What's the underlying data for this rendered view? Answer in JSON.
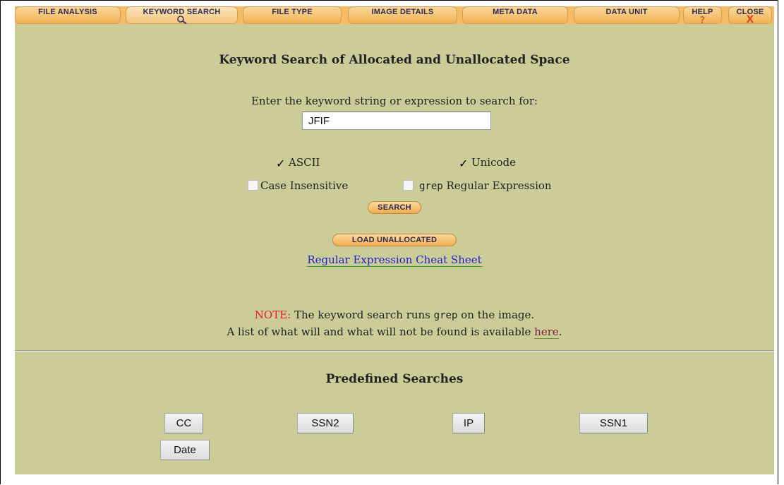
{
  "tabs": [
    {
      "label": "File Analysis"
    },
    {
      "label": "Keyword Search",
      "icon": "magnifier-icon"
    },
    {
      "label": "File Type"
    },
    {
      "label": "Image Details"
    },
    {
      "label": "Meta Data"
    },
    {
      "label": "Data Unit"
    },
    {
      "label": "Help",
      "icon_text": "?"
    },
    {
      "label": "Close",
      "icon_text": "X"
    }
  ],
  "main": {
    "title": "Keyword Search of Allocated and Unallocated Space",
    "prompt": "Enter the keyword string or expression to search for:",
    "keyword_value": "JFIF",
    "options": {
      "ascii": {
        "label": "ASCII",
        "checked": true
      },
      "unicode": {
        "label": "Unicode",
        "checked": true
      },
      "case_insensitive": {
        "label": "Case Insensitive",
        "checked": false
      },
      "grep_code": "grep",
      "grep_label": "Regular Expression",
      "grep_checked": false
    },
    "search_button": "Search",
    "load_unallocated_button": "Load Unallocated",
    "cheat_sheet_link": "Regular Expression Cheat Sheet",
    "note": {
      "label": "NOTE:",
      "line1_pre": "The keyword search runs",
      "line1_code": "grep",
      "line1_post": "on the image.",
      "line2_pre": "A list of what will and what will not be found is available",
      "line2_link": "here",
      "line2_post": "."
    }
  },
  "predefined": {
    "title": "Predefined Searches",
    "buttons": [
      "CC",
      "SSN2",
      "IP",
      "SSN1",
      "Date"
    ]
  },
  "colors": {
    "page_bg": "#cccc99",
    "tab_bg": "#f5bd63",
    "note_red": "#e02020",
    "link_blue": "#2222cc"
  }
}
